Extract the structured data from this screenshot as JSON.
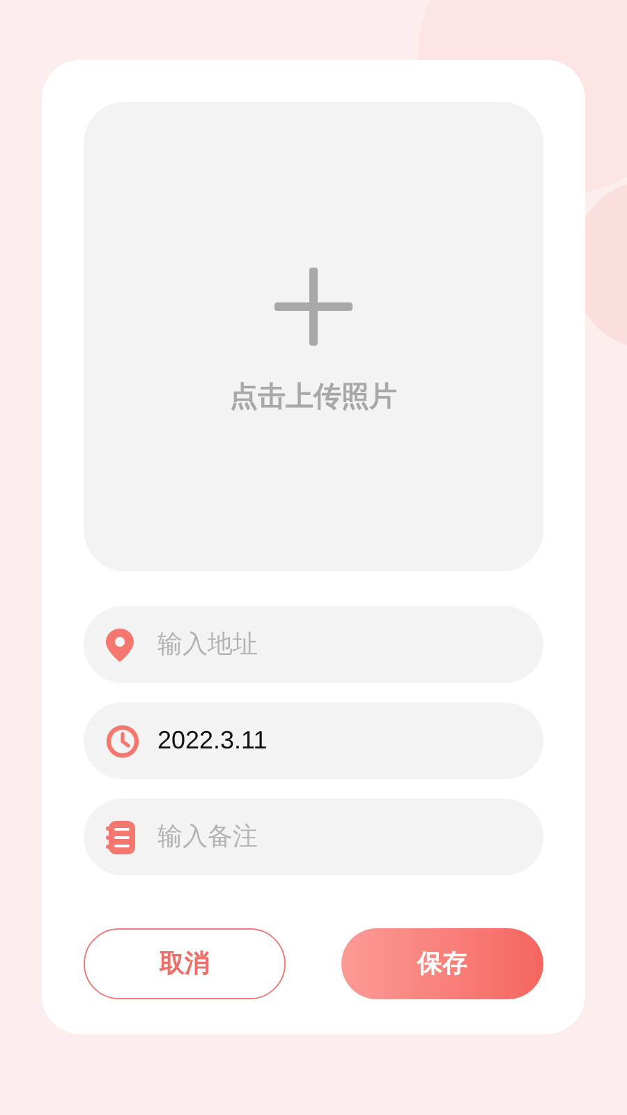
{
  "upload": {
    "label": "点击上传照片"
  },
  "fields": [
    {
      "kind": "location",
      "placeholder": "输入地址"
    },
    {
      "kind": "time",
      "value": "2022.3.11"
    },
    {
      "kind": "note",
      "placeholder": "输入备注"
    }
  ],
  "buttons": [
    {
      "kind": "outline",
      "label": "取消"
    },
    {
      "kind": "filled",
      "label": "保存"
    }
  ]
}
